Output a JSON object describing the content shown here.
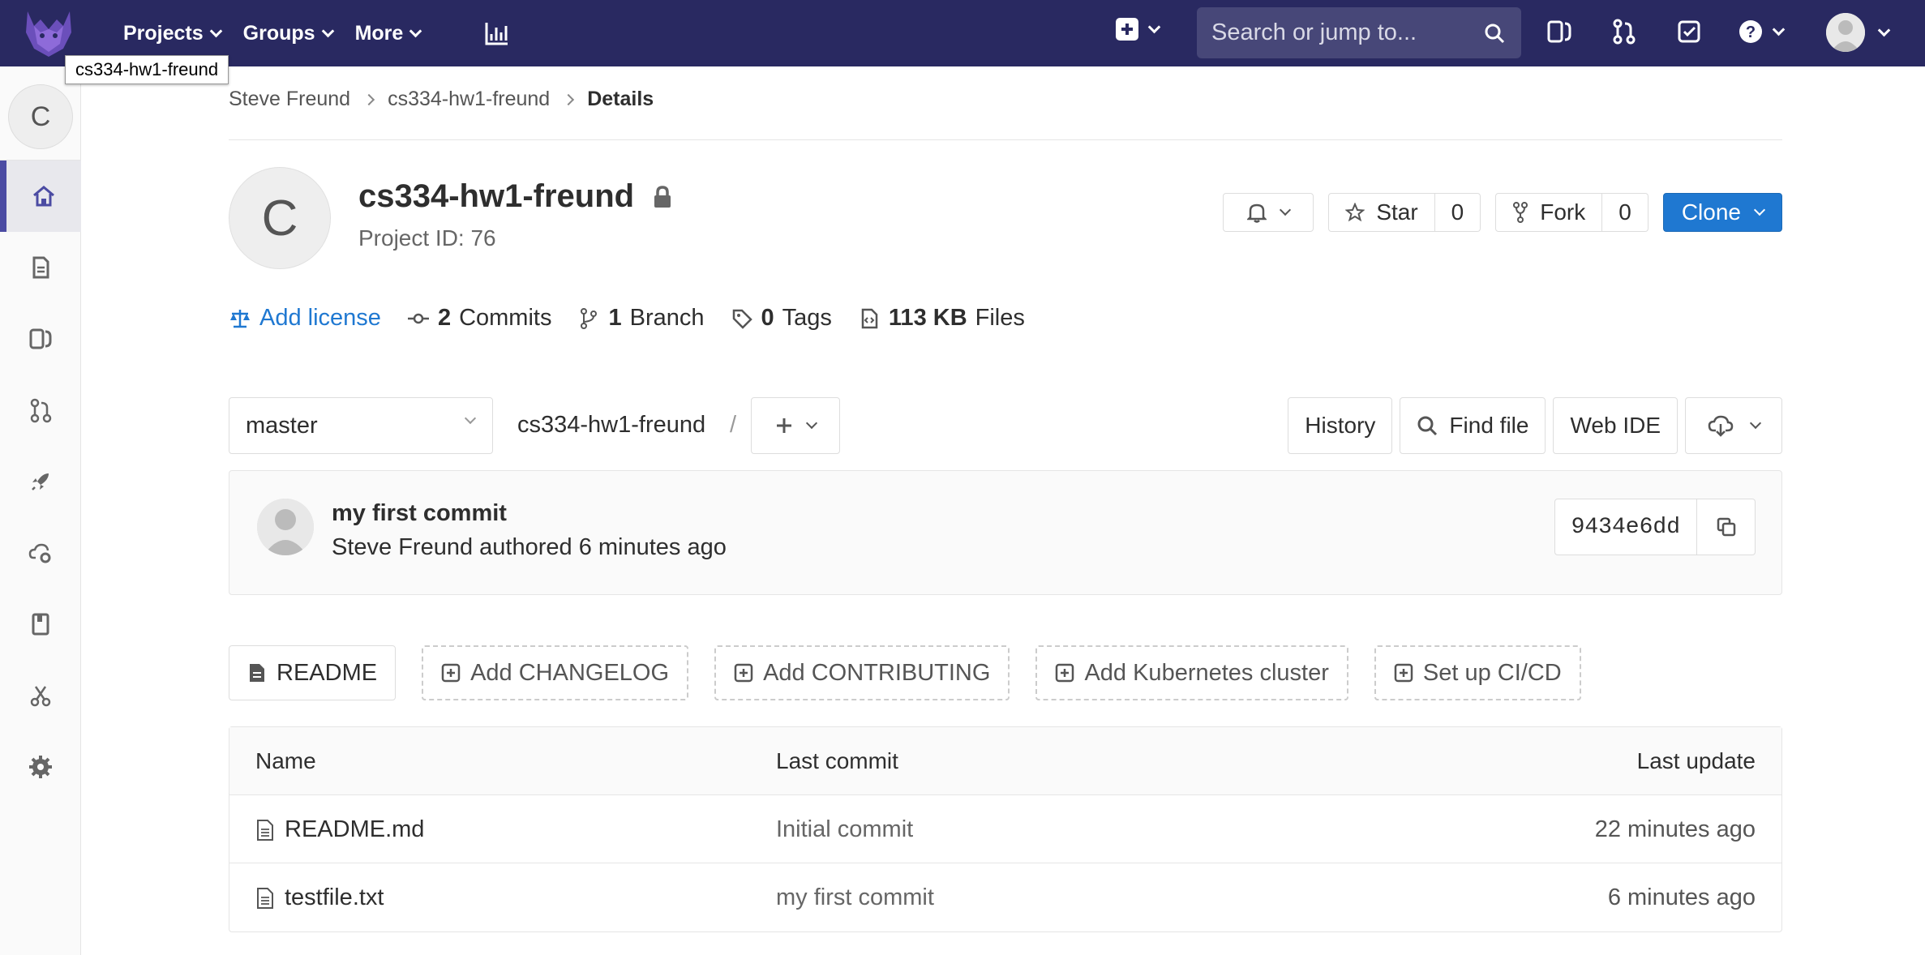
{
  "navbar": {
    "projects": "Projects",
    "groups": "Groups",
    "more": "More",
    "search_placeholder": "Search or jump to...",
    "tooltip": "cs334-hw1-freund"
  },
  "sidebar": {
    "project_letter": "C"
  },
  "breadcrumb": {
    "items": [
      "Steve Freund",
      "cs334-hw1-freund",
      "Details"
    ]
  },
  "project": {
    "avatar_letter": "C",
    "name": "cs334-hw1-freund",
    "id_label": "Project ID: 76"
  },
  "actions": {
    "star_label": "Star",
    "star_count": "0",
    "fork_label": "Fork",
    "fork_count": "0",
    "clone_label": "Clone"
  },
  "stats": {
    "license": "Add license",
    "commits_num": "2",
    "commits_label": "Commits",
    "branch_num": "1",
    "branch_label": "Branch",
    "tags_num": "0",
    "tags_label": "Tags",
    "files_num": "113 KB",
    "files_label": "Files"
  },
  "toolbar": {
    "branch": "master",
    "path": "cs334-hw1-freund",
    "slash": "/",
    "history": "History",
    "find_file": "Find file",
    "web_ide": "Web IDE"
  },
  "commit": {
    "title": "my first commit",
    "meta": "Steve Freund authored 6 minutes ago",
    "sha": "9434e6dd"
  },
  "quick": {
    "readme": "README",
    "changelog": "Add CHANGELOG",
    "contributing": "Add CONTRIBUTING",
    "kubernetes": "Add Kubernetes cluster",
    "cicd": "Set up CI/CD"
  },
  "table": {
    "headers": {
      "name": "Name",
      "commit": "Last commit",
      "update": "Last update"
    },
    "rows": [
      {
        "name": "README.md",
        "commit": "Initial commit",
        "update": "22 minutes ago"
      },
      {
        "name": "testfile.txt",
        "commit": "my first commit",
        "update": "6 minutes ago"
      }
    ]
  },
  "colors": {
    "navbar": "#292961",
    "accent": "#1f78d1",
    "sidebar_active": "#4b4ba3"
  }
}
